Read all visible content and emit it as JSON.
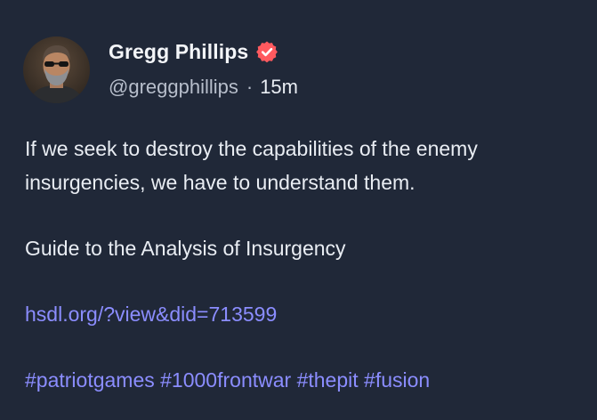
{
  "author": {
    "display_name": "Gregg Phillips",
    "handle": "@greggphillips",
    "separator": "·",
    "timestamp": "15m",
    "verified_color": "#ff5a5f"
  },
  "post": {
    "line1": "If we seek to destroy the capabilities of the enemy",
    "line2": "insurgencies, we have to understand them.",
    "title_line": "Guide to the Analysis of Insurgency",
    "link_text": "hsdl.org/?view&did=713599",
    "hashtags": [
      "#patriotgames",
      "#1000frontwar",
      "#thepit",
      "#fusion"
    ]
  },
  "colors": {
    "background": "#202838",
    "link": "#8b8dff",
    "text": "#e9edf3",
    "muted": "#b7becb"
  },
  "icons": {
    "verified": "verified-badge-icon",
    "avatar": "avatar-photo"
  }
}
